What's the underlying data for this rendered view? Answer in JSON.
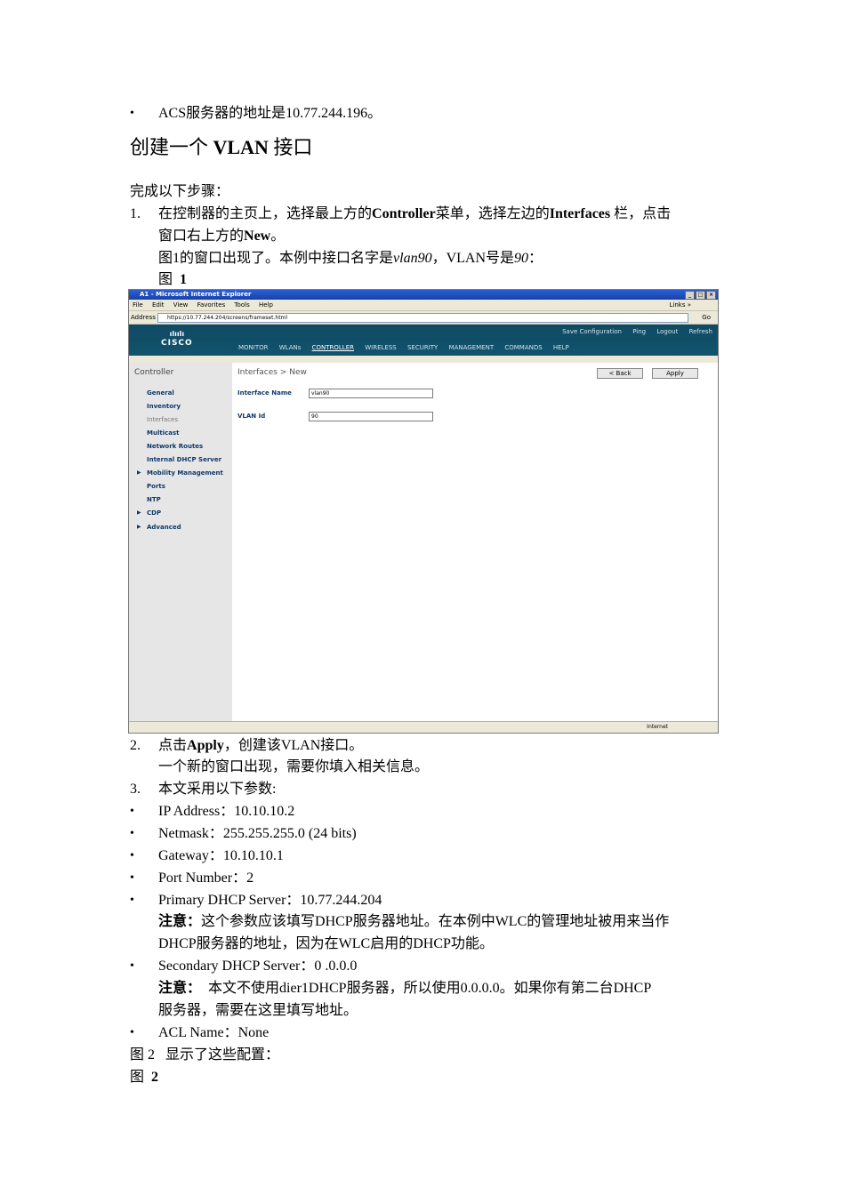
{
  "doc": {
    "intro_bullet": "ACS服务器的地址是10.77.244.196。",
    "heading": {
      "pre": "创建一个 ",
      "bold": "VLAN",
      "post": " 接口"
    },
    "lead": "完成以下步骤：",
    "step1": {
      "num": "1.",
      "a": "在控制器的主页上，选择最上方的",
      "b": "Controller",
      "c": "菜单，选择左边的",
      "d": "Interfaces",
      "e": " 栏，点击",
      "line2_pre": "窗口右上方的",
      "line2_bold": "New",
      "line2_post": "。",
      "line3_a": "图1的窗口出现了。本例中接口名字是",
      "line3_i1": "vlan90",
      "line3_b": "，VLAN号是",
      "line3_i2": "90",
      "line3_c": "：",
      "fig_label": "图  ",
      "fig_num": "1"
    },
    "step2": {
      "num": "2.",
      "a": "点击",
      "b": "Apply",
      "c": "，创建该VLAN接口。",
      "line2": "一个新的窗口出现，需要你填入相关信息。"
    },
    "step3": {
      "num": "3.",
      "text": "本文采用以下参数:"
    },
    "params": [
      "IP Address：10.10.10.2",
      "Netmask：255.255.255.0 (24 bits)",
      "Gateway：10.10.10.1",
      "Port Number：2",
      "Primary DHCP Server：10.77.244.204"
    ],
    "note1": {
      "bold": "注意：",
      "line1": "这个参数应该填写DHCP服务器地址。在本例中WLC的管理地址被用来当作",
      "line2": "DHCP服务器的地址，因为在WLC启用的DHCP功能。"
    },
    "secondary": "Secondary DHCP Server：0 .0.0.0",
    "note2": {
      "bold": "注意：",
      "line1": "  本文不使用dier1DHCP服务器，所以使用0.0.0.0。如果你有第二台DHCP",
      "line2": "服务器，需要在这里填写地址。"
    },
    "acl": "ACL Name：None",
    "fig2_caption": "图 2   显示了这些配置：",
    "fig2_label": "图  ",
    "fig2_num": "2",
    "bullet_char": "•"
  },
  "screenshot": {
    "window_title": "A1 - Microsoft Internet Explorer",
    "window_buttons": [
      "_",
      "□",
      "×"
    ],
    "menu": [
      "File",
      "Edit",
      "View",
      "Favorites",
      "Tools",
      "Help"
    ],
    "links_label": "Links »",
    "address_label": "Address",
    "url": "https://10.77.244.204/screens/frameset.html",
    "go_label": "Go",
    "logo_bars": "ılıılı",
    "logo_text": "CISCO",
    "top_links": [
      "Save Configuration",
      "Ping",
      "Logout",
      "Refresh"
    ],
    "nav": [
      "MONITOR",
      "WLANs",
      "CONTROLLER",
      "WIRELESS",
      "SECURITY",
      "MANAGEMENT",
      "COMMANDS",
      "HELP"
    ],
    "nav_active": "CONTROLLER",
    "sidebar_title": "Controller",
    "sidebar_items": [
      "General",
      "Inventory",
      "Interfaces",
      "Multicast",
      "Network Routes",
      "Internal DHCP Server",
      "Mobility Management",
      "Ports",
      "NTP",
      "CDP",
      "Advanced"
    ],
    "breadcrumb": "Interfaces > New",
    "back_button": "< Back",
    "apply_button": "Apply",
    "interface_name_label": "Interface Name",
    "interface_name_value": "vlan90",
    "vlan_id_label": "VLAN Id",
    "vlan_id_value": "90",
    "status_zone": "Internet"
  }
}
